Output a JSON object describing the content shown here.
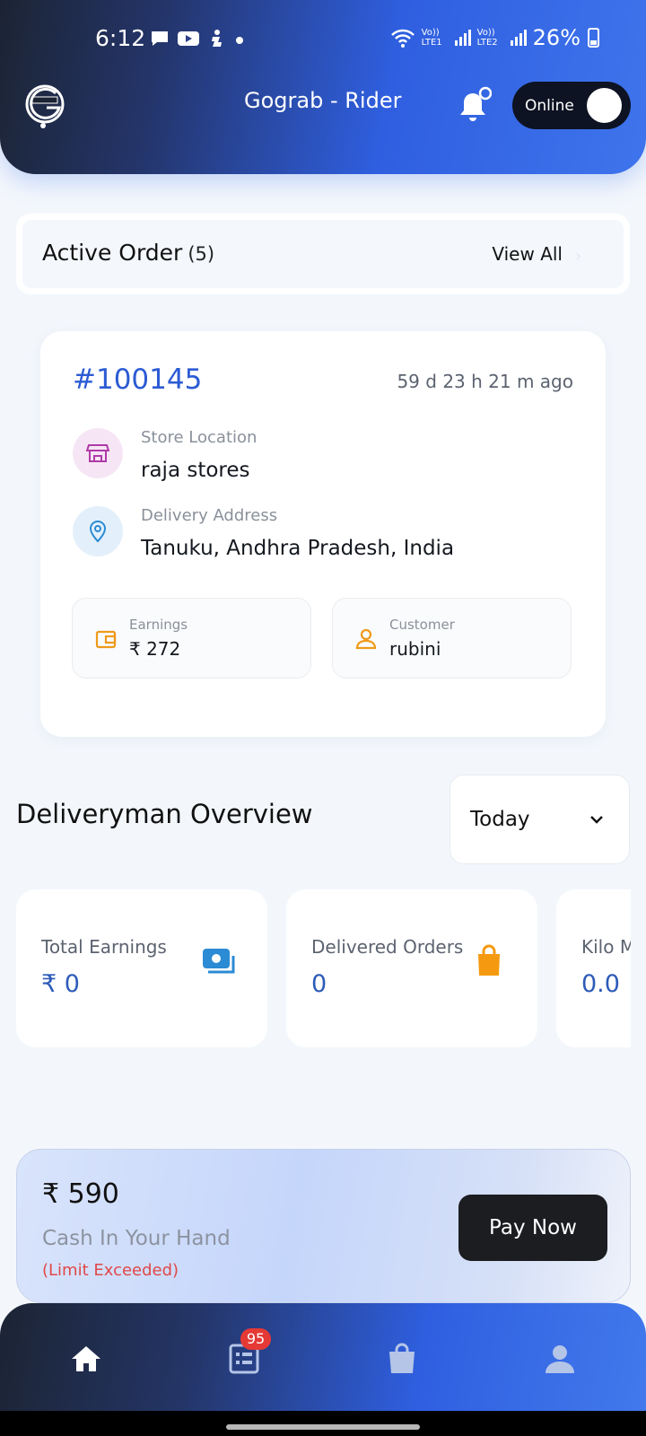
{
  "status_bar": {
    "time": "6:12",
    "signal_1": "Vo)) LTE1",
    "signal_2": "Vo)) LTE2",
    "battery": "26%"
  },
  "header": {
    "title": "Gograb - Rider",
    "online_label": "Online",
    "online": true
  },
  "active_order": {
    "title": "Active Order",
    "count": "(5)",
    "view_all": "View All"
  },
  "order": {
    "id": "#100145",
    "time_ago": "59 d 23 h 21 m ago",
    "store_label": "Store Location",
    "store_value": "raja stores",
    "delivery_label": "Delivery Address",
    "delivery_value": "Tanuku, Andhra Pradesh, India",
    "earnings_label": "Earnings",
    "earnings_value": "₹ 272",
    "customer_label": "Customer",
    "customer_value": "rubini"
  },
  "overview": {
    "title": "Deliveryman Overview",
    "period": "Today",
    "stats": [
      {
        "label": "Total Earnings",
        "value": "₹ 0",
        "icon": "money-icon"
      },
      {
        "label": "Delivered Orders",
        "value": "0",
        "icon": "bag-icon"
      },
      {
        "label": "Kilo M",
        "value": "0.0",
        "icon": ""
      }
    ]
  },
  "cash": {
    "amount": "₹ 590",
    "label": "Cash In Your Hand",
    "warning": "(Limit Exceeded)",
    "pay_button": "Pay Now"
  },
  "bottom_nav": {
    "items": [
      "home-icon",
      "orders-list-icon",
      "shopping-bag-icon",
      "profile-icon"
    ],
    "orders_badge": "95"
  },
  "colors": {
    "accent": "#2c5bd3",
    "warning": "#e04848",
    "badge": "#e53935"
  }
}
